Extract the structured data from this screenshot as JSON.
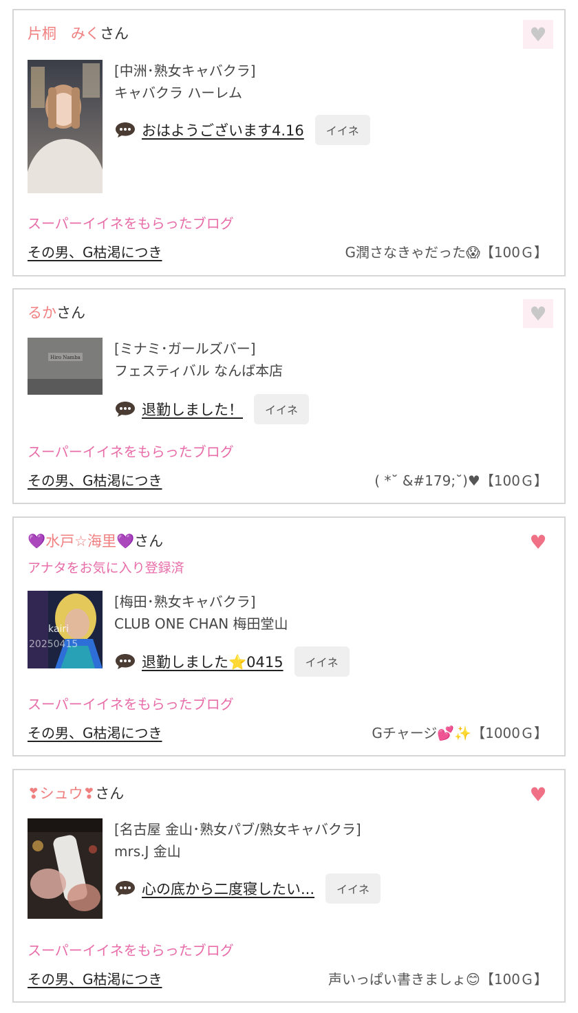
{
  "colors": {
    "name": "#f08080",
    "pink": "#e86ca8",
    "heart_on": "#f07185",
    "heart_off": "#c8c8c8"
  },
  "cards": [
    {
      "name": "片桐　みく",
      "san": "さん",
      "favorite_status": "",
      "favorited": false,
      "area": "[中洲･熟女キャバクラ]",
      "shop": "キャバクラ ハーレム",
      "blog_title": "おはようございます4.16",
      "iine": "イイネ",
      "super_label": "スーパーイイネをもらったブログ",
      "man": "その男、G枯渇につき",
      "comment": "G潤さなきゃだった😱【100Ｇ】"
    },
    {
      "name": "るか",
      "san": "さん",
      "favorite_status": "",
      "favorited": false,
      "area": "[ミナミ･ガールズバー]",
      "shop": "フェスティバル なんば本店",
      "blog_title": "退勤しました！",
      "iine": "イイネ",
      "super_label": "スーパーイイネをもらったブログ",
      "man": "その男、G枯渇につき",
      "comment": "( *˘ &#179;˘)♥【100Ｇ】"
    },
    {
      "name": "💜水戸☆海里💜",
      "san": "さん",
      "favorite_status": "アナタをお気に入り登録済",
      "favorited": true,
      "area": "[梅田･熟女キャバクラ]",
      "shop": "CLUB ONE CHAN 梅田堂山",
      "blog_title": "退勤しました⭐0415",
      "iine": "イイネ",
      "super_label": "スーパーイイネをもらったブログ",
      "man": "その男、G枯渇につき",
      "comment": "Gチャージ💕✨【1000Ｇ】",
      "photo_overlay": "kairi 20250415"
    },
    {
      "name": "❣シュウ❣",
      "san": "さん",
      "favorite_status": "",
      "favorited": true,
      "area": "[名古屋 金山･熟女パブ/熟女キャバクラ]",
      "shop": "mrs.J 金山",
      "blog_title": "心の底から二度寝したい...",
      "iine": "イイネ",
      "super_label": "スーパーイイネをもらったブログ",
      "man": "その男、G枯渇につき",
      "comment": "声いっぱい書きましょ😊【100Ｇ】"
    }
  ]
}
